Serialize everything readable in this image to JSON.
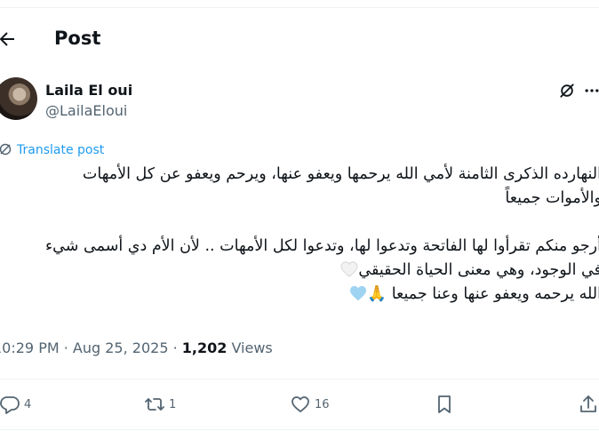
{
  "header": {
    "title": "Post"
  },
  "author": {
    "name": "Laila El oui",
    "handle": "@LailaEloui"
  },
  "translate_label": "Translate post",
  "post": {
    "lines": [
      "النهارده الذكرى الثامنة لأمي الله يرحمها ويعفو عنها، ويرحم ويعفو عن كل الأمهات",
      "والأموات جميعاً",
      "",
      "أرجو منكم تقرأوا لها الفاتحة وتدعوا لها، وتدعوا لكل الأمهات .. لأن الأم دي أسمى شيء",
      "في الوجود، وهي معنى الحياة الحقيقي",
      "الله يرحمه ويعفو عنها وعنا جميعا 🙏"
    ]
  },
  "meta": {
    "time": "10:29 PM",
    "separator1": " · ",
    "date": "Aug 25, 2025",
    "separator2": " · ",
    "views_count": "1,202",
    "views_label": " Views"
  },
  "actions": {
    "replies": "4",
    "reposts": "1",
    "likes": "16"
  },
  "colors": {
    "accent": "#1d9bf0",
    "muted": "#536471",
    "text": "#0f1419",
    "light_heart": "#9fd3f2"
  }
}
